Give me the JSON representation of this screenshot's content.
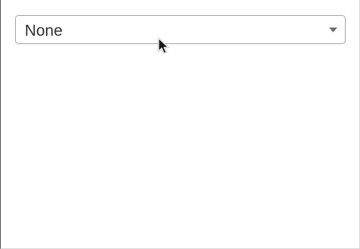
{
  "dropdown": {
    "selected_value": "None",
    "icon": "chevron-down-icon"
  },
  "pointer": {
    "icon": "mouse-pointer-icon"
  }
}
